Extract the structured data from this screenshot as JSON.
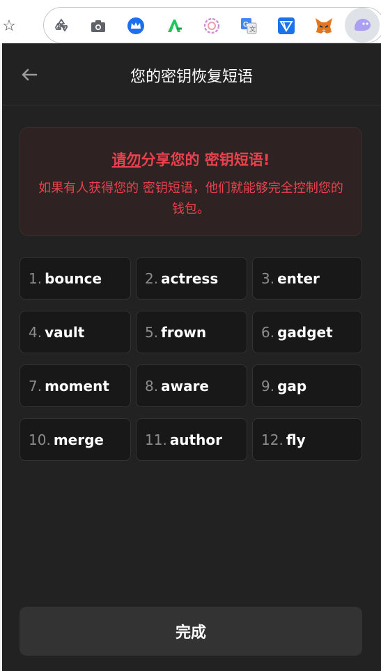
{
  "browser": {
    "extensions": [
      {
        "name": "recycle-extension-icon",
        "color": "#5f6368"
      },
      {
        "name": "camera-extension-icon",
        "color": "#5f6368"
      },
      {
        "name": "crown-extension-icon",
        "color": "#1e6ff0"
      },
      {
        "name": "a-extension-icon",
        "color": "#22c55e"
      },
      {
        "name": "swirl-extension-icon",
        "color": "#d08cd5"
      },
      {
        "name": "translate-extension-icon",
        "color": "#4285f4"
      },
      {
        "name": "send-extension-icon",
        "color": "#1a73e8"
      },
      {
        "name": "fox-extension-icon",
        "color": "#e2761b"
      },
      {
        "name": "ghost-extension-icon",
        "color": "#ab9ff2"
      }
    ]
  },
  "popup": {
    "title": "您的密钥恢复短语",
    "warning": {
      "title_pre": "请勿",
      "title_rest": "分享您的 密钥短语!",
      "body": "如果有人获得您的 密钥短语，他们就能够完全控制您的钱包。"
    },
    "words": [
      {
        "num": "1.",
        "word": "bounce"
      },
      {
        "num": "2.",
        "word": "actress"
      },
      {
        "num": "3.",
        "word": "enter"
      },
      {
        "num": "4.",
        "word": "vault"
      },
      {
        "num": "5.",
        "word": "frown"
      },
      {
        "num": "6.",
        "word": "gadget"
      },
      {
        "num": "7.",
        "word": "moment"
      },
      {
        "num": "8.",
        "word": "aware"
      },
      {
        "num": "9.",
        "word": "gap"
      },
      {
        "num": "10.",
        "word": "merge"
      },
      {
        "num": "11.",
        "word": "author"
      },
      {
        "num": "12.",
        "word": "fly"
      }
    ],
    "done_label": "完成"
  }
}
